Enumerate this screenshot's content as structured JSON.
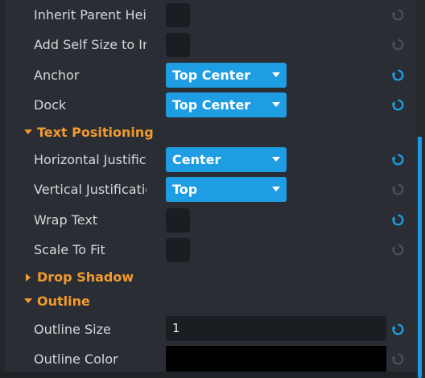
{
  "colors": {
    "accent": "#1f9de3",
    "section_title": "#f29a2e",
    "reset_active": "#1f9de3",
    "reset_inactive": "#4a4e55"
  },
  "rows": {
    "inherit_parent_height": {
      "label": "Inherit Parent Heig"
    },
    "add_self_size": {
      "label": "Add Self Size to Inl"
    },
    "anchor": {
      "label": "Anchor",
      "value": "Top Center"
    },
    "dock": {
      "label": "Dock",
      "value": "Top Center"
    },
    "horizontal_justification": {
      "label": "Horizontal Justific",
      "value": "Center"
    },
    "vertical_justification": {
      "label": "Vertical Justificatio",
      "value": "Top"
    },
    "wrap_text": {
      "label": "Wrap Text"
    },
    "scale_to_fit": {
      "label": "Scale To Fit"
    },
    "outline_size": {
      "label": "Outline Size",
      "value": "1"
    },
    "outline_color": {
      "label": "Outline Color"
    }
  },
  "sections": {
    "text_positioning": {
      "title": "Text Positioning",
      "expanded": true
    },
    "drop_shadow": {
      "title": "Drop Shadow",
      "expanded": false
    },
    "outline": {
      "title": "Outline",
      "expanded": true
    }
  },
  "icons": {
    "reset": "reset-arrow-icon",
    "expanded": "caret-down-icon",
    "collapsed": "caret-right-icon",
    "dropdown": "dropdown-caret-icon"
  }
}
